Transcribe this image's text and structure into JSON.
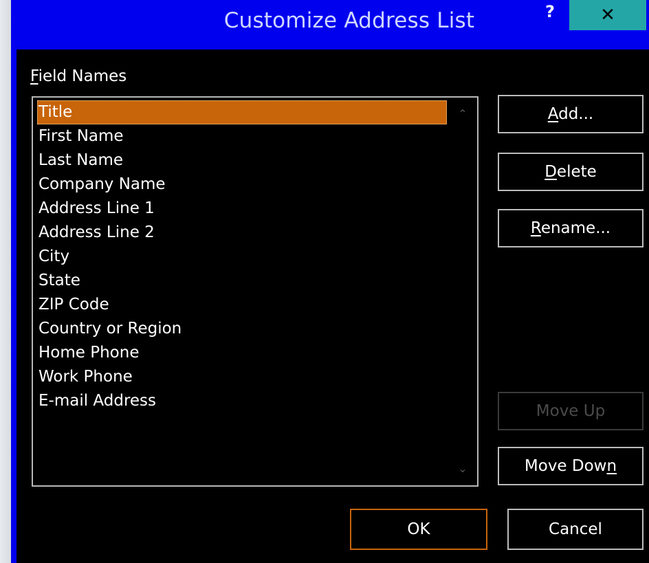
{
  "dialog": {
    "title": "Customize Address List",
    "help_label": "?",
    "close_label": "✕"
  },
  "field_names": {
    "label_accel": "F",
    "label_rest": "ield Names",
    "items": [
      "Title",
      "First Name",
      "Last Name",
      "Company Name",
      "Address Line 1",
      "Address Line 2",
      "City",
      "State",
      "ZIP Code",
      "Country or Region",
      "Home Phone",
      "Work Phone",
      "E-mail Address"
    ],
    "selected": "Title"
  },
  "buttons": {
    "add_accel": "A",
    "add_rest": "dd...",
    "delete_accel": "D",
    "delete_rest": "elete",
    "rename_accel": "R",
    "rename_rest": "ename...",
    "move_up": "Move Up",
    "move_down_pre": "Move Dow",
    "move_down_accel": "n",
    "ok": "OK",
    "cancel": "Cancel"
  },
  "colors": {
    "title_bar": "#0000ee",
    "close_button": "#25a6a6",
    "selection": "#c8650a",
    "background": "#000000"
  },
  "icons": {
    "scroll_up": "chevron-up-icon",
    "scroll_down": "chevron-down-icon"
  }
}
